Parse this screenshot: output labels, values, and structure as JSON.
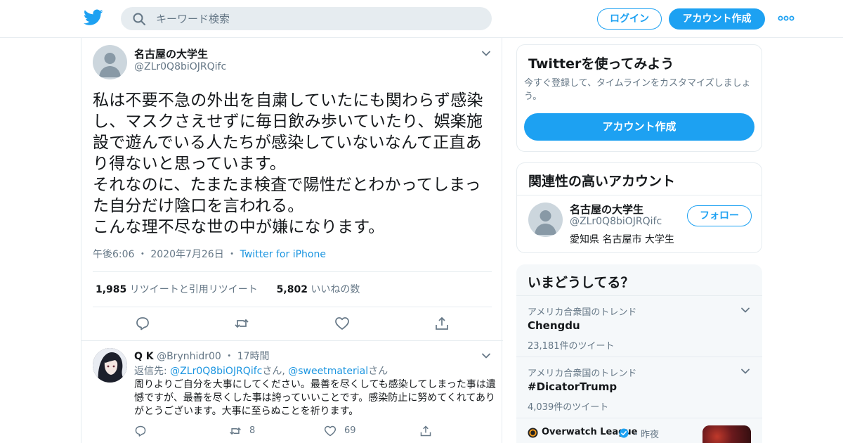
{
  "header": {
    "search_placeholder": "キーワード検索",
    "login_label": "ログイン",
    "signup_label": "アカウント作成"
  },
  "tweet": {
    "name": "名古屋の大学生",
    "handle": "@ZLr0Q8biOJRQifc",
    "text": "私は不要不急の外出を自粛していたにも関わらず感染し、マスクさえせずに毎日飲み歩いていたり、娯楽施設で遊んでいる人たちが感染していないなんて正直あり得ないと思っています。\nそれなのに、たまたま検査で陽性だとわかってしまった自分だけ陰口を言われる。\nこんな理不尽な世の中が嫌になります。",
    "time": "午後6:06",
    "date": "2020年7月26日",
    "source": "Twitter for iPhone",
    "retweets_count": "1,985",
    "retweets_label": "リツイートと引用リツイート",
    "likes_count": "5,802",
    "likes_label": "いいねの数"
  },
  "reply": {
    "name": "Q K",
    "handle": "@Brynhidr00",
    "time": "17時間",
    "reply_prefix": "返信先:",
    "reply_to_1": "@ZLr0Q8biOJRQifc",
    "reply_san_1": "さん,",
    "reply_to_2": "@sweetmaterial",
    "reply_san_2": "さん",
    "text": "周りよりご自分を大事にしてください。最善を尽くしても感染してしまった事は遺憾ですが、最善を尽くした事は誇っていいことです。感染防止に努めてくれてありがとうございます。大事に至らぬことを祈ります。",
    "retweets": "8",
    "likes": "69"
  },
  "signup_card": {
    "title": "Twitterを使ってみよう",
    "description": "今すぐ登録して、タイムラインをカスタマイズしましょう。",
    "button": "アカウント作成"
  },
  "related_card": {
    "title": "関連性の高いアカウント",
    "name": "名古屋の大学生",
    "handle": "@ZLr0Q8biOJRQifc",
    "bio": "愛知県 名古屋市 大学生",
    "follow_label": "フォロー"
  },
  "trends_card": {
    "title": "いまどうしてる？",
    "items": [
      {
        "location": "アメリカ合衆国のトレンド",
        "name": "Chengdu",
        "count": "23,181件のツイート"
      },
      {
        "location": "アメリカ合衆国のトレンド",
        "name": "#DicatorTrump",
        "count": "4,039件のツイート"
      }
    ],
    "news_source": "Overwatch League",
    "news_time": "昨夜"
  },
  "colors": {
    "accent": "#1da1f2",
    "link": "#1b95e0",
    "muted": "#657786",
    "border": "#e6ecf0"
  }
}
